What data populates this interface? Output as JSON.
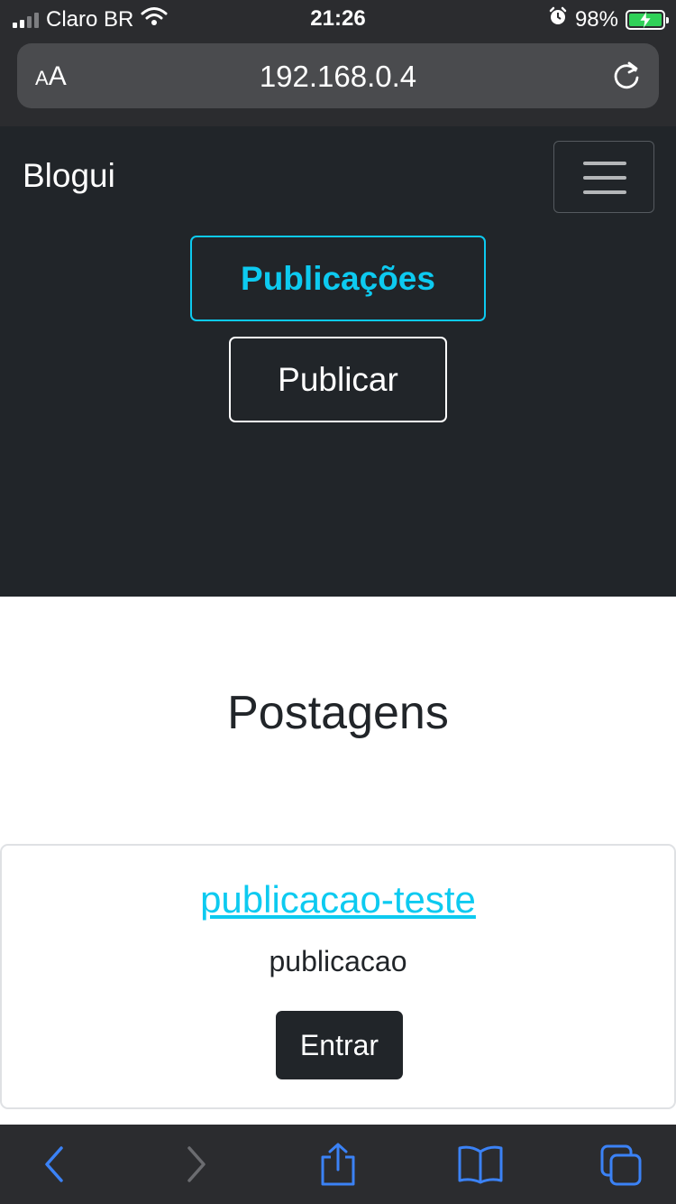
{
  "status_bar": {
    "carrier": "Claro BR",
    "time": "21:26",
    "battery_percent": "98%",
    "battery_level": 0.98,
    "charging": true
  },
  "browser": {
    "text_size_label_small": "A",
    "text_size_label_large": "A",
    "url": "192.168.0.4"
  },
  "navbar": {
    "brand": "Blogui",
    "links": [
      {
        "label": "Publicações",
        "active": true
      },
      {
        "label": "Publicar",
        "active": false
      }
    ]
  },
  "main": {
    "heading": "Postagens",
    "posts": [
      {
        "title": "publicacao-teste",
        "body": "publicacao",
        "button_label": "Entrar"
      }
    ]
  },
  "toolbar": {
    "icons": [
      "back-arrow-icon",
      "forward-arrow-icon",
      "share-icon",
      "bookmarks-icon",
      "tabs-icon"
    ]
  },
  "colors": {
    "navbar_bg": "#212529",
    "accent": "#0dcaf0",
    "browser_chrome": "#2b2c2f",
    "ios_blue": "#3b82f6",
    "battery_green": "#30d158"
  }
}
